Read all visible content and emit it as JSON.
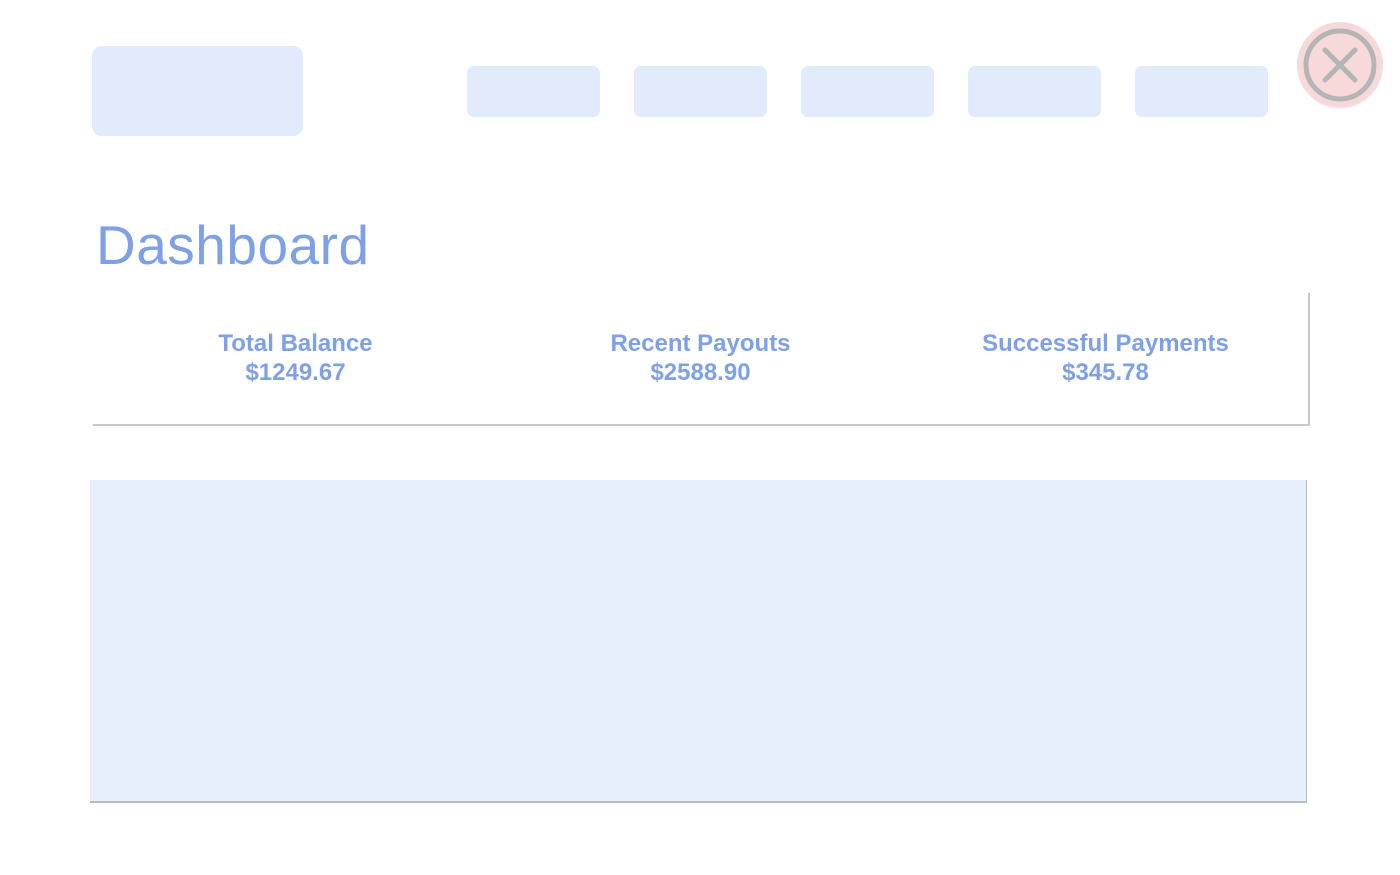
{
  "header": {
    "nav_items": [
      "",
      "",
      "",
      "",
      ""
    ]
  },
  "colors": {
    "accent": "#7ea0e6",
    "placeholder_fill": "#e1ebfc",
    "content_fill": "#e7eefc",
    "close_fill": "#f7d9d9",
    "close_glyph": "#b5b5b5"
  },
  "icons": {
    "close": "close-icon"
  },
  "main": {
    "title": "Dashboard",
    "stats": [
      {
        "label": "Total Balance",
        "value": "$1249.67"
      },
      {
        "label": "Recent Payouts",
        "value": "$2588.90"
      },
      {
        "label": "Successful Payments",
        "value": "$345.78"
      }
    ]
  }
}
